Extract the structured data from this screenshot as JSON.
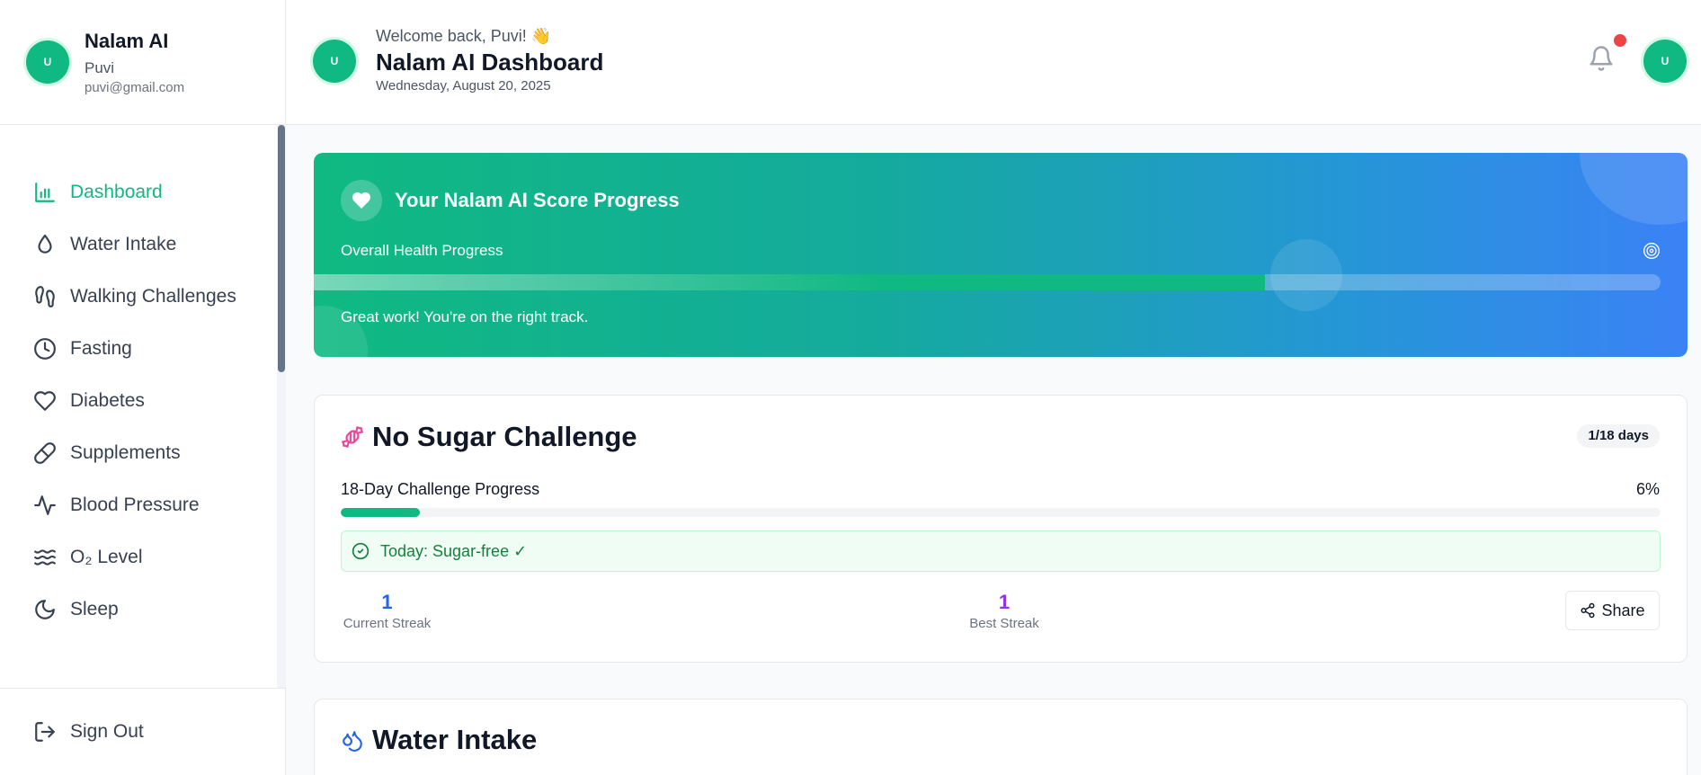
{
  "sidebar": {
    "avatar_initial": "U",
    "app_name": "Nalam AI",
    "user_name": "Puvi",
    "email": "puvi@gmail.com",
    "items": [
      {
        "label": "Dashboard",
        "icon": "bar-chart-icon",
        "active": true
      },
      {
        "label": "Water Intake",
        "icon": "droplet-icon"
      },
      {
        "label": "Walking Challenges",
        "icon": "footprints-icon"
      },
      {
        "label": "Fasting",
        "icon": "clock-icon"
      },
      {
        "label": "Diabetes",
        "icon": "heart-icon"
      },
      {
        "label": "Supplements",
        "icon": "pill-icon"
      },
      {
        "label": "Blood Pressure",
        "icon": "activity-icon"
      },
      {
        "label": "O₂ Level",
        "icon": "waves-icon"
      },
      {
        "label": "Sleep",
        "icon": "moon-icon"
      }
    ],
    "sign_out": "Sign Out"
  },
  "header": {
    "avatar_initial": "U",
    "welcome": "Welcome back, Puvi! 👋",
    "title": "Nalam AI Dashboard",
    "date": "Wednesday, August 20, 2025",
    "has_notification": true
  },
  "score": {
    "title": "Your Nalam AI Score Progress",
    "subtitle": "Overall Health Progress",
    "progress": 0.706,
    "message": "Great work! You're on the right track."
  },
  "challenge": {
    "title": "No Sugar Challenge",
    "badge": "1/18 days",
    "progress_label": "18-Day Challenge Progress",
    "progress_text": "6%",
    "progress": 0.06,
    "today": "Today: Sugar-free ✓",
    "current_streak": "1",
    "current_streak_label": "Current Streak",
    "best_streak": "1",
    "best_streak_label": "Best Streak",
    "share": "Share"
  },
  "water": {
    "title": "Water Intake"
  },
  "colors": {
    "brand": "#10b981",
    "accent_blue": "#3b82f6",
    "notification": "#ef4444",
    "candy": "#ec4899",
    "best_streak": "#9333ea",
    "current_streak": "#2563eb"
  }
}
